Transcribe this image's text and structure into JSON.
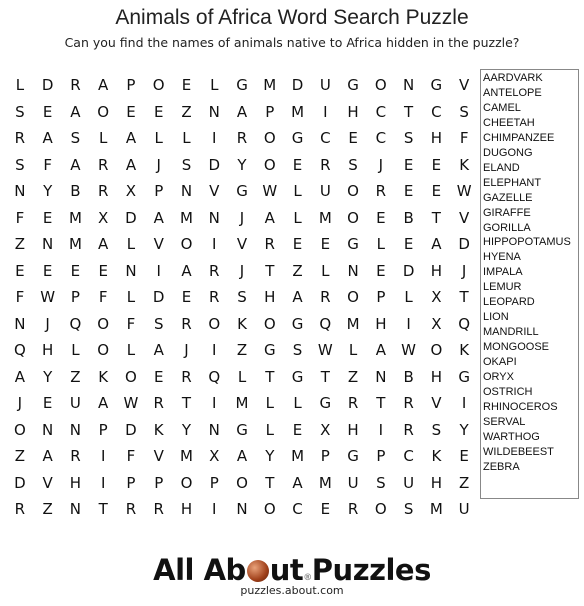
{
  "header": {
    "title": "Animals of Africa Word Search Puzzle",
    "subtitle": "Can you find the names of animals native to Africa hidden in the puzzle?"
  },
  "grid": [
    [
      "L",
      "D",
      "R",
      "A",
      "P",
      "O",
      "E",
      "L",
      "G",
      "M",
      "D",
      "U",
      "G",
      "O",
      "N",
      "G",
      "V"
    ],
    [
      "S",
      "E",
      "A",
      "O",
      "E",
      "E",
      "Z",
      "N",
      "A",
      "P",
      "M",
      "I",
      "H",
      "C",
      "T",
      "C",
      "S"
    ],
    [
      "R",
      "A",
      "S",
      "L",
      "A",
      "L",
      "L",
      "I",
      "R",
      "O",
      "G",
      "C",
      "E",
      "C",
      "S",
      "H",
      "F"
    ],
    [
      "S",
      "F",
      "A",
      "R",
      "A",
      "J",
      "S",
      "D",
      "Y",
      "O",
      "E",
      "R",
      "S",
      "J",
      "E",
      "E",
      "K"
    ],
    [
      "N",
      "Y",
      "B",
      "R",
      "X",
      "P",
      "N",
      "V",
      "G",
      "W",
      "L",
      "U",
      "O",
      "R",
      "E",
      "E",
      "W"
    ],
    [
      "F",
      "E",
      "M",
      "X",
      "D",
      "A",
      "M",
      "N",
      "J",
      "A",
      "L",
      "M",
      "O",
      "E",
      "B",
      "T",
      "V"
    ],
    [
      "Z",
      "N",
      "M",
      "A",
      "L",
      "V",
      "O",
      "I",
      "V",
      "R",
      "E",
      "E",
      "G",
      "L",
      "E",
      "A",
      "D"
    ],
    [
      "E",
      "E",
      "E",
      "E",
      "N",
      "I",
      "A",
      "R",
      "J",
      "T",
      "Z",
      "L",
      "N",
      "E",
      "D",
      "H",
      "J"
    ],
    [
      "F",
      "W",
      "P",
      "F",
      "L",
      "D",
      "E",
      "R",
      "S",
      "H",
      "A",
      "R",
      "O",
      "P",
      "L",
      "X",
      "T"
    ],
    [
      "N",
      "J",
      "Q",
      "O",
      "F",
      "S",
      "R",
      "O",
      "K",
      "O",
      "G",
      "Q",
      "M",
      "H",
      "I",
      "X",
      "Q"
    ],
    [
      "Q",
      "H",
      "L",
      "O",
      "L",
      "A",
      "J",
      "I",
      "Z",
      "G",
      "S",
      "W",
      "L",
      "A",
      "W",
      "O",
      "K"
    ],
    [
      "A",
      "Y",
      "Z",
      "K",
      "O",
      "E",
      "R",
      "Q",
      "L",
      "T",
      "G",
      "T",
      "Z",
      "N",
      "B",
      "H",
      "G"
    ],
    [
      "J",
      "E",
      "U",
      "A",
      "W",
      "R",
      "T",
      "I",
      "M",
      "L",
      "L",
      "G",
      "R",
      "T",
      "R",
      "V",
      "I"
    ],
    [
      "O",
      "N",
      "N",
      "P",
      "D",
      "K",
      "Y",
      "N",
      "G",
      "L",
      "E",
      "X",
      "H",
      "I",
      "R",
      "S",
      "Y"
    ],
    [
      "Z",
      "A",
      "R",
      "I",
      "F",
      "V",
      "M",
      "X",
      "A",
      "Y",
      "M",
      "P",
      "G",
      "P",
      "C",
      "K",
      "E"
    ],
    [
      "D",
      "V",
      "H",
      "I",
      "P",
      "P",
      "O",
      "P",
      "O",
      "T",
      "A",
      "M",
      "U",
      "S",
      "U",
      "H",
      "Z"
    ],
    [
      "R",
      "Z",
      "N",
      "T",
      "R",
      "R",
      "H",
      "I",
      "N",
      "O",
      "C",
      "E",
      "R",
      "O",
      "S",
      "M",
      "U"
    ]
  ],
  "words": [
    "AARDVARK",
    "ANTELOPE",
    "CAMEL",
    "CHEETAH",
    "CHIMPANZEE",
    "DUGONG",
    "ELAND",
    "ELEPHANT",
    "GAZELLE",
    "GIRAFFE",
    "GORILLA",
    "HIPPOPOTAMUS",
    "HYENA",
    "IMPALA",
    "LEMUR",
    "LEOPARD",
    "LION",
    "MANDRILL",
    "MONGOOSE",
    "OKAPI",
    "ORYX",
    "OSTRICH",
    "RHINOCEROS",
    "SERVAL",
    "WARTHOG",
    "WILDEBEEST",
    "ZEBRA"
  ],
  "footer": {
    "logo_part1": "All Ab",
    "logo_part2": "ut",
    "logo_reg": "®",
    "logo_part3": "Puzzles",
    "url": "puzzles.about.com"
  }
}
